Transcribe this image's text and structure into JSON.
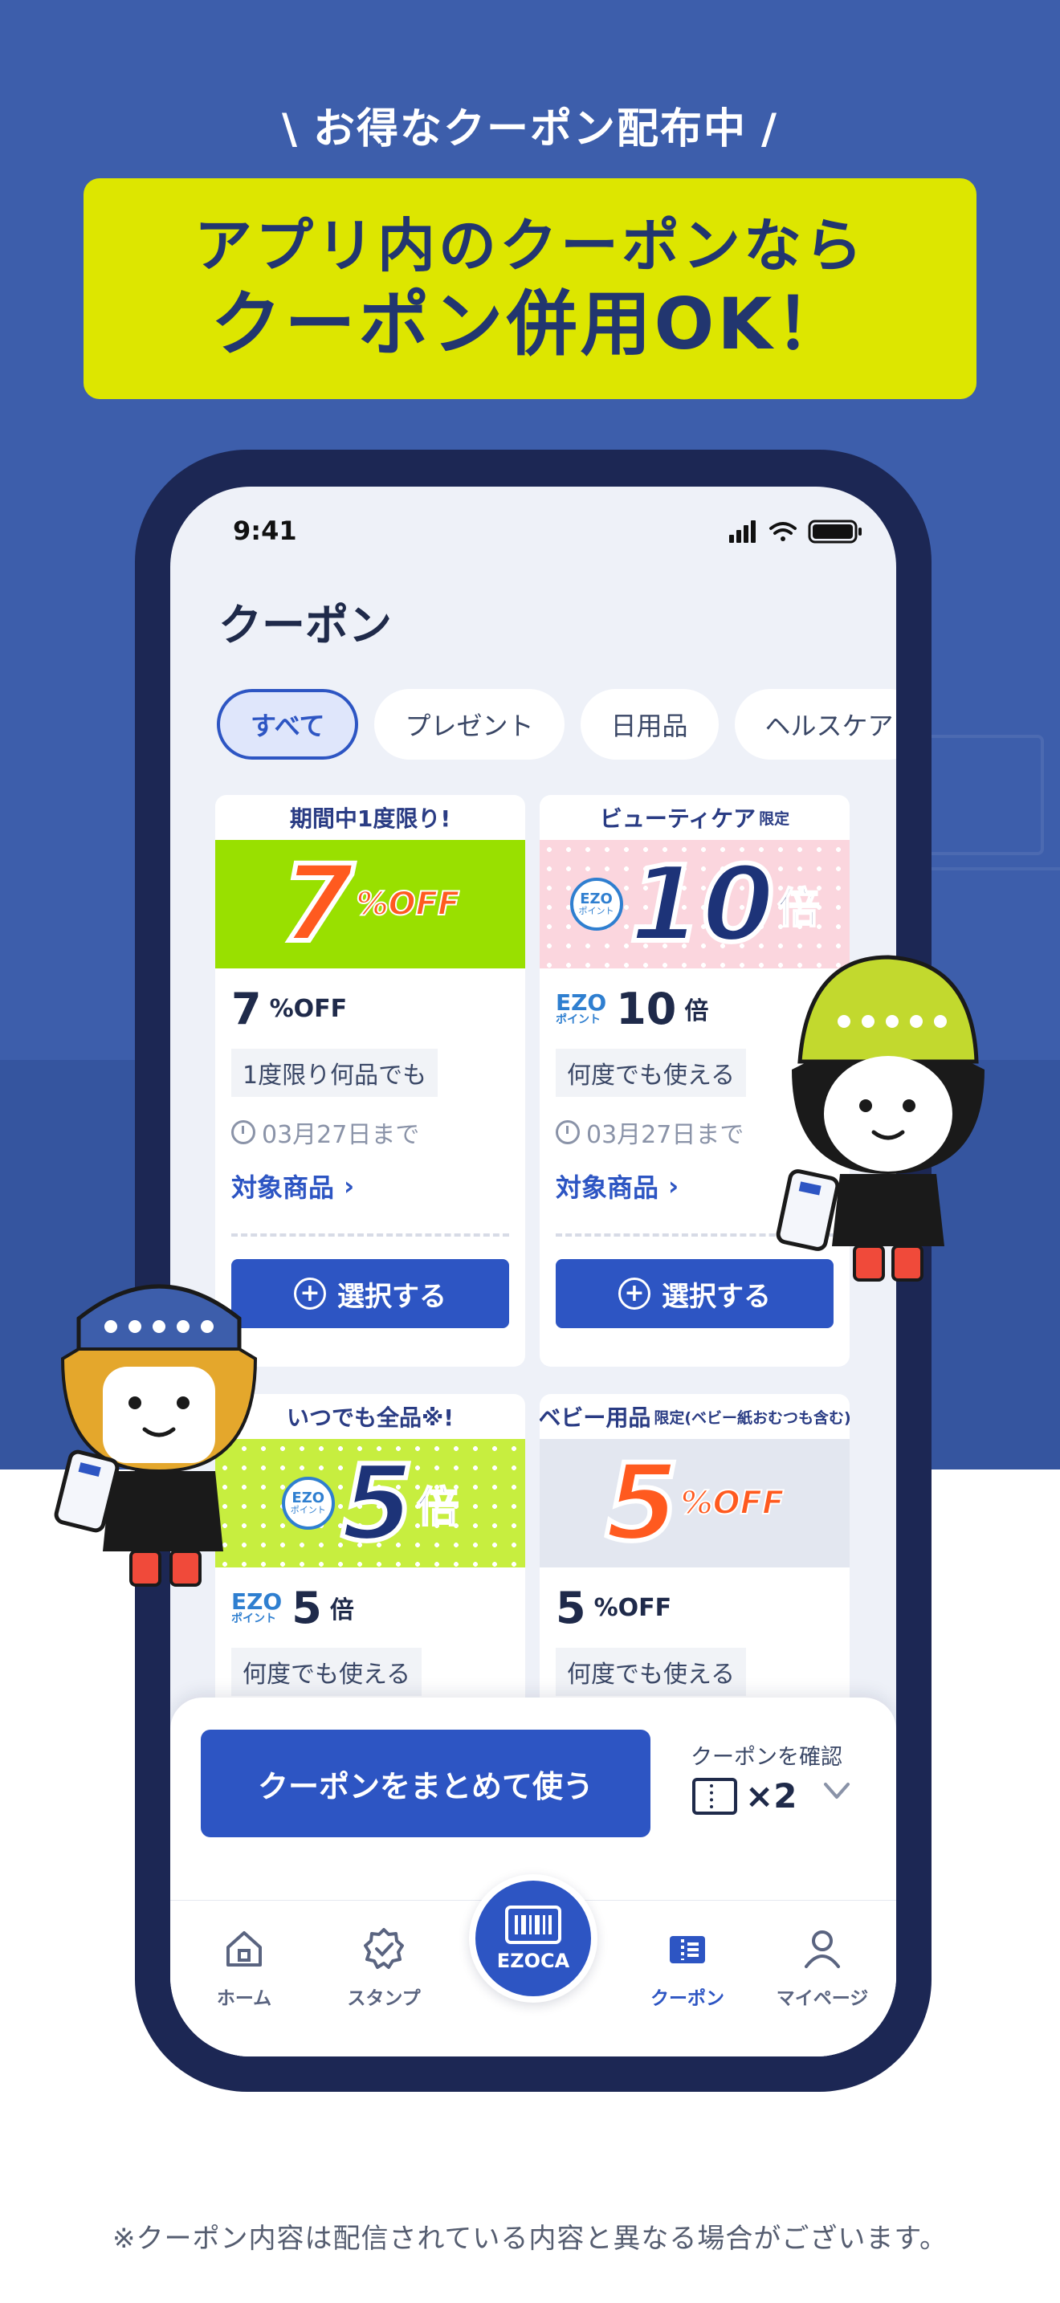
{
  "promo": {
    "tagline": "お得なクーポン配布中",
    "slash_left": "\\",
    "slash_right": "/",
    "banner_line1": "アプリ内のクーポンなら",
    "banner_line2": "クーポン併用OK！"
  },
  "status_bar": {
    "time": "9:41"
  },
  "page": {
    "title": "クーポン"
  },
  "filter_chips": [
    {
      "label": "すべて",
      "active": true
    },
    {
      "label": "プレゼント",
      "active": false
    },
    {
      "label": "日用品",
      "active": false
    },
    {
      "label": "ヘルスケア",
      "active": false
    }
  ],
  "coupons": [
    {
      "header": "期間中1度限り!",
      "art_value": "7",
      "art_unit": "%OFF",
      "value": "7",
      "unit": "%OFF",
      "condition": "1度限り何品でも",
      "expiry": "03月27日まで",
      "target_link": "対象商品",
      "select_label": "選択する"
    },
    {
      "header": "ビューティケア",
      "header_suffix": "限定",
      "art_value": "10",
      "art_unit": "倍",
      "value": "10",
      "unit": "倍",
      "point_brand": "EZO",
      "point_label": "ポイント",
      "condition": "何度でも使える",
      "expiry": "03月27日まで",
      "target_link": "対象商品",
      "select_label": "選択する"
    },
    {
      "header": "いつでも全品※!",
      "art_value": "5",
      "art_unit": "倍",
      "value": "5",
      "unit": "倍",
      "point_brand": "EZO",
      "point_label": "ポイント",
      "condition": "何度でも使える"
    },
    {
      "header": "ベビー用品",
      "header_suffix": "限定(ベビー紙おむつも含む)",
      "art_value": "5",
      "art_unit": "%OFF",
      "value": "5",
      "unit": "%OFF",
      "condition": "何度でも使える"
    }
  ],
  "bottom_sheet": {
    "use_button": "クーポンをまとめて使う",
    "confirm_label": "クーポンを確認",
    "selected_count": "×2"
  },
  "tabbar": {
    "items": [
      {
        "label": "ホーム",
        "icon": "home-icon"
      },
      {
        "label": "スタンプ",
        "icon": "stamp-icon"
      },
      {
        "label": "EZOCA",
        "icon": "barcode-card-icon"
      },
      {
        "label": "クーポン",
        "icon": "coupon-icon",
        "active": true
      },
      {
        "label": "マイページ",
        "icon": "person-icon"
      }
    ]
  },
  "footnote": "※クーポン内容は配信されている内容と異なる場合がございます。",
  "colors": {
    "background_blue": "#3d5eab",
    "banner_yellow": "#dde600",
    "accent_blue": "#2d55c3",
    "orange": "#ff5a1f",
    "navy": "#1c2754"
  }
}
